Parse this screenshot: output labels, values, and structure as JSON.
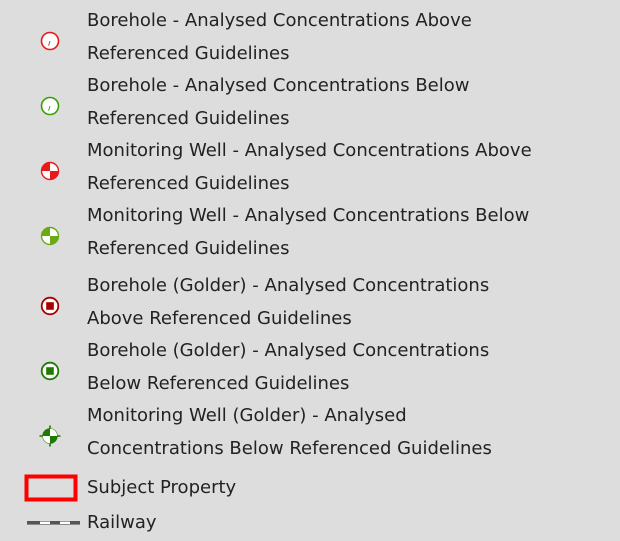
{
  "legend": {
    "items": [
      {
        "symbol": "borehole-above-icon",
        "color": "#e8191c",
        "lines": [
          "Borehole - Analysed Concentrations Above",
          "Referenced Guidelines"
        ]
      },
      {
        "symbol": "borehole-below-icon",
        "color": "#35a100",
        "lines": [
          "Borehole - Analysed Concentrations Below",
          "Referenced Guidelines"
        ]
      },
      {
        "symbol": "monitoring-well-above-icon",
        "color": "#e8191c",
        "lines": [
          "Monitoring Well - Analysed Concentrations Above",
          "Referenced Guidelines"
        ]
      },
      {
        "symbol": "monitoring-well-below-icon",
        "color": "#6aaa14",
        "lines": [
          "Monitoring Well - Analysed Concentrations Below",
          "Referenced Guidelines"
        ]
      },
      {
        "symbol": "borehole-golder-above-icon",
        "color": "#a80000",
        "lines": [
          "Borehole (Golder) - Analysed Concentrations",
          "Above Referenced Guidelines"
        ]
      },
      {
        "symbol": "borehole-golder-below-icon",
        "color": "#1e7b00",
        "lines": [
          "Borehole (Golder) - Analysed Concentrations",
          "Below Referenced Guidelines"
        ]
      },
      {
        "symbol": "monitoring-well-golder-below-icon",
        "color": "#1e7b00",
        "lines": [
          "Monitoring Well (Golder) - Analysed",
          "Concentrations Below Referenced Guidelines"
        ]
      },
      {
        "symbol": "subject-property-icon",
        "color": "#ff0000",
        "lines": [
          "Subject Property"
        ]
      },
      {
        "symbol": "railway-icon",
        "color": "#555555",
        "lines": [
          "Railway"
        ]
      }
    ]
  }
}
